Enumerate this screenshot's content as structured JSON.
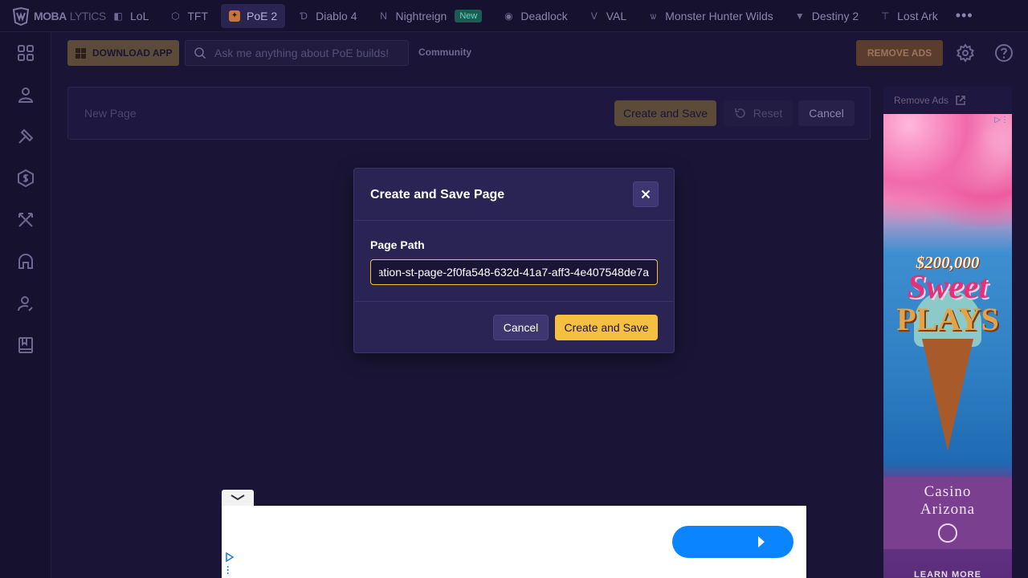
{
  "brand": {
    "logo_text": "MOBA",
    "logo_text_light": "LYTICS"
  },
  "games": [
    {
      "label": "LoL",
      "icon": "lol-icon"
    },
    {
      "label": "TFT",
      "icon": "tft-icon"
    },
    {
      "label": "PoE 2",
      "icon": "poe2-icon",
      "active": true
    },
    {
      "label": "Diablo 4",
      "icon": "diablo4-icon"
    },
    {
      "label": "Nightreign",
      "icon": "nightreign-icon",
      "badge": "New"
    },
    {
      "label": "Deadlock",
      "icon": "deadlock-icon"
    },
    {
      "label": "VAL",
      "icon": "valorant-icon"
    },
    {
      "label": "Monster Hunter Wilds",
      "icon": "monster-hunter-icon"
    },
    {
      "label": "Destiny 2",
      "icon": "destiny2-icon"
    },
    {
      "label": "Lost Ark",
      "icon": "lost-ark-icon"
    }
  ],
  "toolbar": {
    "download_label": "DOWNLOAD APP",
    "search_placeholder": "Ask me anything about PoE builds!",
    "community_label": "Community",
    "remove_ads_label": "REMOVE ADS"
  },
  "editor": {
    "title_placeholder": "New Page",
    "create_label": "Create and Save",
    "reset_label": "Reset",
    "cancel_label": "Cancel"
  },
  "side_ad": {
    "remove_ads_label": "Remove Ads",
    "amount": "$200,000",
    "headline_1": "Sweet",
    "headline_2": "PLAYS",
    "brand_1": "Casino",
    "brand_2": "Arizona",
    "cta": "LEARN MORE"
  },
  "modal": {
    "title": "Create and Save Page",
    "field_label": "Page Path",
    "field_value": "ation-st-page-2f0fa548-632d-41a7-aff3-4e407548de7a",
    "cancel_label": "Cancel",
    "create_label": "Create and Save"
  },
  "colors": {
    "background": "#1a1536",
    "accent": "#f5c040",
    "modal": "#2a2454"
  }
}
